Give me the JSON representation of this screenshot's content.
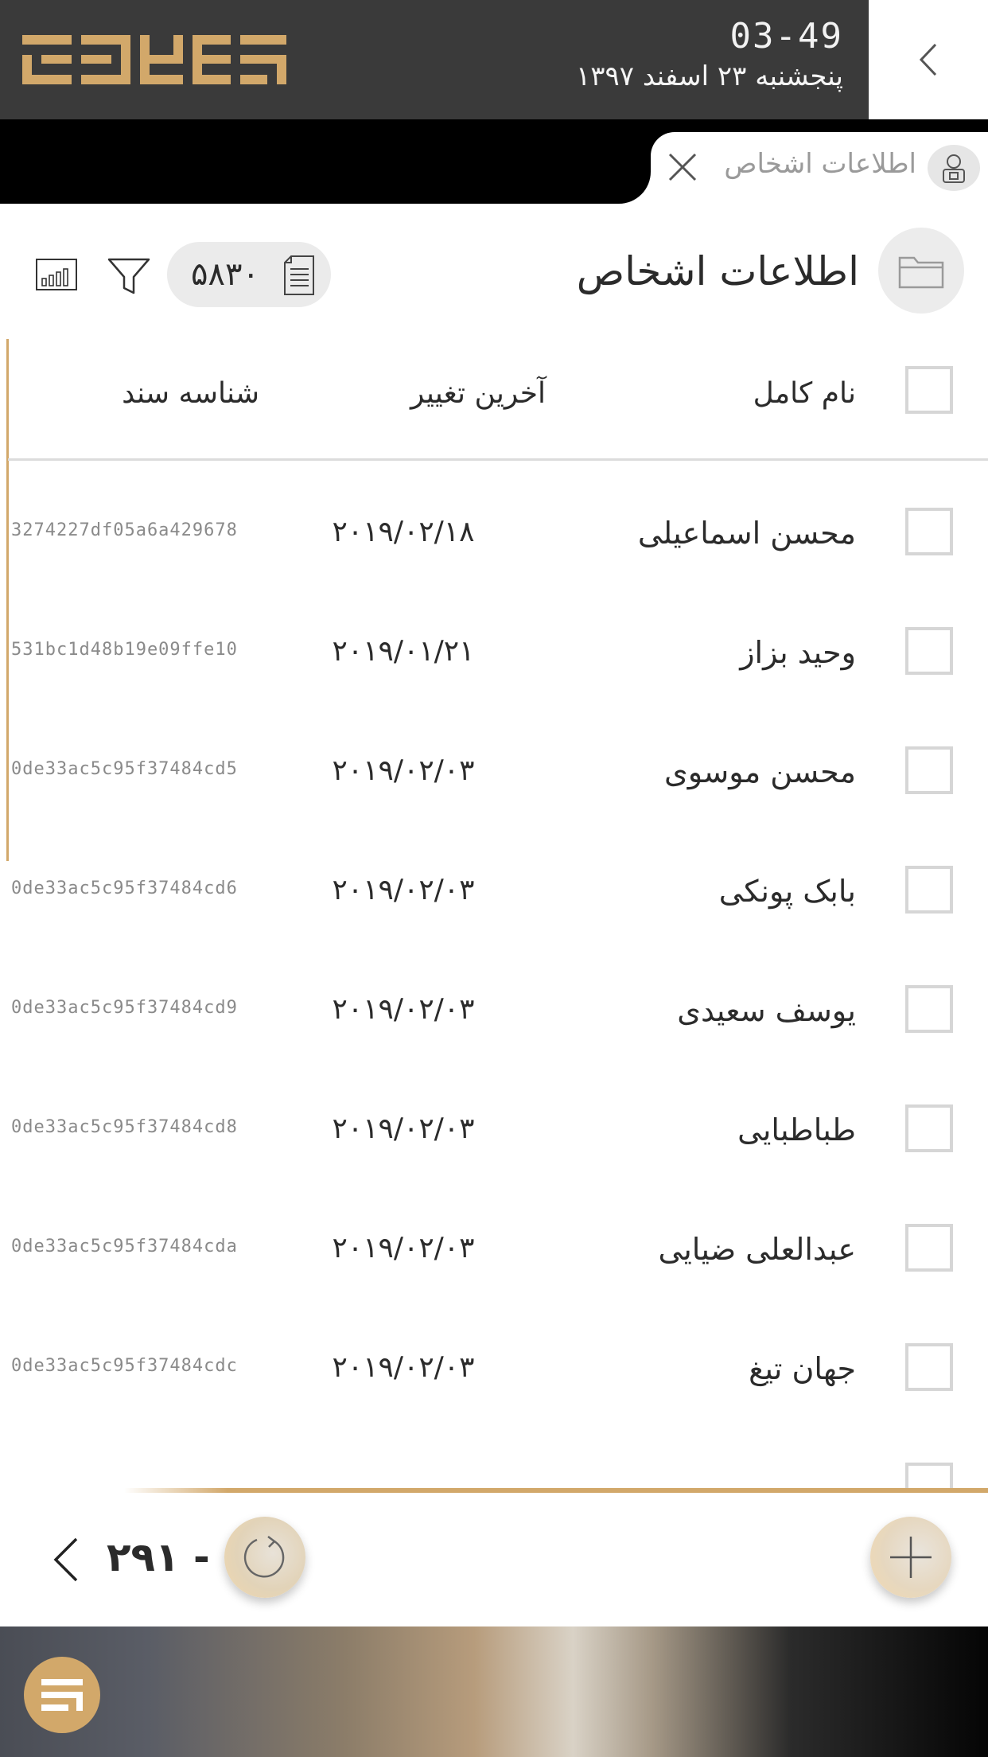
{
  "header": {
    "time": "03-49",
    "date": "پنجشنبه ۲۳ اسفند ۱۳۹۷",
    "brand_color": "#d2a86a"
  },
  "tab": {
    "title": "اطلاعات اشخاص",
    "icon": "person-badge-icon",
    "close_icon": "close-icon"
  },
  "page": {
    "title": "اطلاعات اشخاص",
    "title_icon": "folder-icon",
    "record_count": "۵۸۳۰",
    "count_icon": "document-list-icon",
    "filter_icon": "filter-icon",
    "chart_icon": "bar-chart-icon"
  },
  "table": {
    "columns": {
      "name": "نام کامل",
      "modified": "آخرین تغییر",
      "doc_id": "شناسه سند"
    },
    "rows": [
      {
        "name": "محسن اسماعیلی",
        "modified": "۲۰۱۹/۰۲/۱۸",
        "doc_id": "3274227df05a6a429678"
      },
      {
        "name": "وحید بزاز",
        "modified": "۲۰۱۹/۰۱/۲۱",
        "doc_id": "531bc1d48b19e09ffe10"
      },
      {
        "name": "محسن موسوی",
        "modified": "۲۰۱۹/۰۲/۰۳",
        "doc_id": "0de33ac5c95f37484cd5"
      },
      {
        "name": "بابک پونکی",
        "modified": "۲۰۱۹/۰۲/۰۳",
        "doc_id": "0de33ac5c95f37484cd6"
      },
      {
        "name": "یوسف سعیدی",
        "modified": "۲۰۱۹/۰۲/۰۳",
        "doc_id": "0de33ac5c95f37484cd9"
      },
      {
        "name": "طباطبایی",
        "modified": "۲۰۱۹/۰۲/۰۳",
        "doc_id": "0de33ac5c95f37484cd8"
      },
      {
        "name": "عبدالعلی ضیایی",
        "modified": "۲۰۱۹/۰۲/۰۳",
        "doc_id": "0de33ac5c95f37484cda"
      },
      {
        "name": "جهان تیغ",
        "modified": "۲۰۱۹/۰۲/۰۳",
        "doc_id": "0de33ac5c95f37484cdc"
      }
    ]
  },
  "pager": {
    "range": "۲۹۱ - ۱",
    "prev_icon": "chevron-left-icon",
    "refresh_icon": "refresh-icon",
    "add_icon": "plus-icon"
  }
}
